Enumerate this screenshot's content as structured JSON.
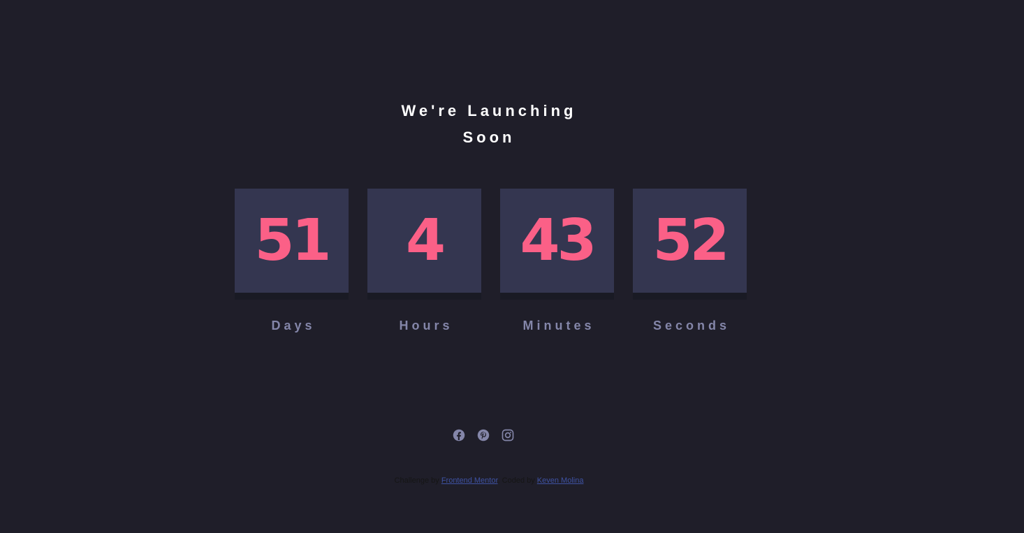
{
  "header": {
    "title_line1": "We're Launching",
    "title_line2": "Soon"
  },
  "countdown": [
    {
      "value": "51",
      "label": "Days"
    },
    {
      "value": "4",
      "label": "Hours"
    },
    {
      "value": "43",
      "label": "Minutes"
    },
    {
      "value": "52",
      "label": "Seconds"
    }
  ],
  "social": [
    {
      "name": "facebook-icon"
    },
    {
      "name": "pinterest-icon"
    },
    {
      "name": "instagram-icon"
    }
  ],
  "attribution": {
    "prefix": "Challenge by",
    "link1": "Frontend Mentor",
    "middle": ". Coded by",
    "link2": "Keven Molina"
  },
  "colors": {
    "background": "#1f1e29",
    "card": "#343650",
    "number": "#fb6087",
    "label": "#8486a9",
    "icon": "#8486a9",
    "link": "#3e52a3"
  }
}
